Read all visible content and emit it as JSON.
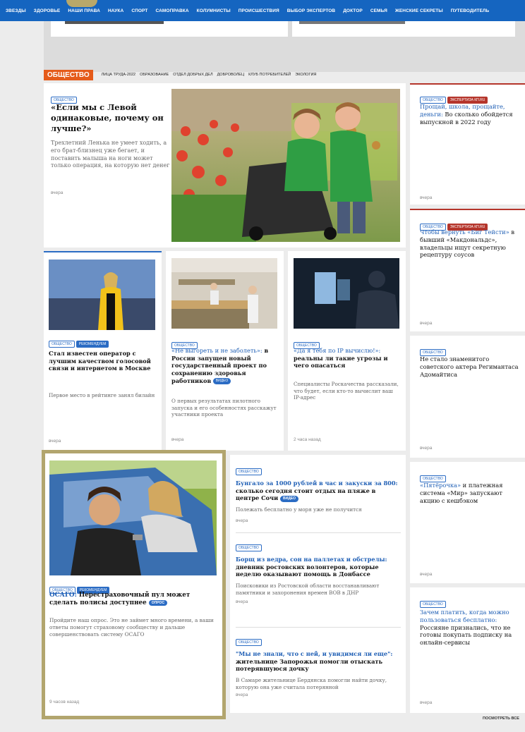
{
  "topnav": [
    "ЗВЕЗДЫ",
    "ЗДОРОВЬЕ",
    "НАШИ ПРАВА",
    "НАУКА",
    "СПОРТ",
    "САМОПРАВКА",
    "КОЛУМНИСТЫ",
    "ПРОИСШЕСТВИЯ",
    "ВЫБОР ЭКСПЕРТОВ",
    "ДОКТОР",
    "СЕМЬЯ",
    "ЖЕНСКИЕ СЕКРЕТЫ",
    "ПУТЕВОДИТЕЛЬ"
  ],
  "section": {
    "title": "ОБЩЕСТВО",
    "subnav": [
      "ЛИЦА ТРУДА-2022",
      "ОБРАЗОВАНИЕ",
      "ОТДЕЛ ДОБРЫХ ДЕЛ",
      "ДОБРОВОЛЕЦ",
      "КЛУБ ПОТРЕБИТЕЛЕЙ",
      "ЭКОЛОГИЯ"
    ]
  },
  "feature": {
    "tag": "ОБЩЕСТВО",
    "title": "«Если мы с Левой одинаковые, почему он лучше?»",
    "lead": "Трехлетний Ленька не умеет ходить, а его брат-близнец уже бегает, и поставить малыша на ноги может только операция, на которую нет денег",
    "time": "вчера"
  },
  "side": [
    {
      "tags": [
        "ОБЩЕСТВО",
        "ЭКСПЕРТИЗА КП.RU"
      ],
      "link": "Прощай, школа, прощайте, деньги:",
      "rest": " Во сколько обойдется выпускной в 2022 году",
      "time": "вчера"
    },
    {
      "tags": [
        "ОБЩЕСТВО",
        "ЭКСПЕРТИЗА КП.RU"
      ],
      "link": "Чтобы вернуть «Биг Тейсти»",
      "rest": " в бывший «Макдональдс», владельцы ищут секретную рецептуру соусов",
      "time": "вчера"
    },
    {
      "tags": [
        "ОБЩЕСТВО"
      ],
      "link": "",
      "rest": "Не стало знаменитого советского актера Регимантаса Адомайтиса",
      "time": "вчера"
    },
    {
      "tags": [
        "ОБЩЕСТВО"
      ],
      "link": "«Пятёрочка»",
      "rest": " и платежная система «Мир» запускают акцию с кешбэком",
      "time": "вчера"
    },
    {
      "tags": [
        "ОБЩЕСТВО"
      ],
      "link": "Зачем платить, когда можно пользоваться бесплатно:",
      "rest": " Россияне признались, что не готовы покупать подписку на онлайн-сервисы",
      "time": "вчера"
    }
  ],
  "row2": [
    {
      "tags": [
        "ОБЩЕСТВО",
        "РЕКОМЕНДУЕМ"
      ],
      "link": "",
      "rest": "Стал известен оператор с лучшим качеством голосовой связи и интернетом в Москве",
      "lead": "Первое место в рейтинге занял билайн",
      "time": "вчера"
    },
    {
      "tags": [
        "ОБЩЕСТВО"
      ],
      "link": "«Не выгореть и не заболеть»:",
      "rest": " в России запущен новый государственный проект по сохранению здоровья работников",
      "pill": "ВИДЕО",
      "lead": "О первых результатах пилотного запуска и его особенностях расскажут участники проекта",
      "time": "вчера"
    },
    {
      "tags": [
        "ОБЩЕСТВО"
      ],
      "link": "«Да я тебя по IP вычислю!»:",
      "rest": " реальны ли такие угрозы и чего опасаться",
      "lead": "Специалисты Роскачества рассказали, что будет, если кто-то вычислит ваш IP-адрес",
      "time": "2 часа назад"
    }
  ],
  "osago": {
    "tags": [
      "ОБЩЕСТВО",
      "РЕКОМЕНДУЕМ"
    ],
    "link": "ОСАГО:",
    "rest": " Перестраховочный пул может сделать полисы доступнее",
    "pill": "ОПРОС",
    "lead": "Пройдите наш опрос. Это не займет много времени, а ваши ответы помогут страховому сообществу и дальше совершенствовать систему ОСАГО",
    "time": "9 часов назад"
  },
  "list": [
    {
      "tag": "ОБЩЕСТВО",
      "link": "Бунгало за 1000 рублей в час и закуски за 800:",
      "rest": " сколько сегодня стоит отдых на пляже в центре Сочи",
      "pill": "ВИДЕО",
      "lead": "Полежать бесплатно у моря уже не получится",
      "time": "вчера"
    },
    {
      "tag": "ОБЩЕСТВО",
      "link": "Борщ из ведра, сон на паллетах и обстрелы:",
      "rest": " дневник ростовских волонтеров, которые неделю оказывают помощь в Донбассе",
      "lead": "Поисковики из Ростовской области восстанавливают памятники и захоронения времен ВОВ в ДНР",
      "time": "вчера"
    },
    {
      "tag": "ОБЩЕСТВО",
      "link": "\"Мы не знали, что с ней, и увидимся ли еще\":",
      "rest": " жительнице Запорожья помогли отыскать потерявшуюся дочку",
      "lead": "В Самаре жительнице Бердянска помогли найти дочку, которую она уже считала потерянной",
      "time": "вчера"
    }
  ],
  "more": "ПОСМОТРЕТЬ ВСЕ"
}
